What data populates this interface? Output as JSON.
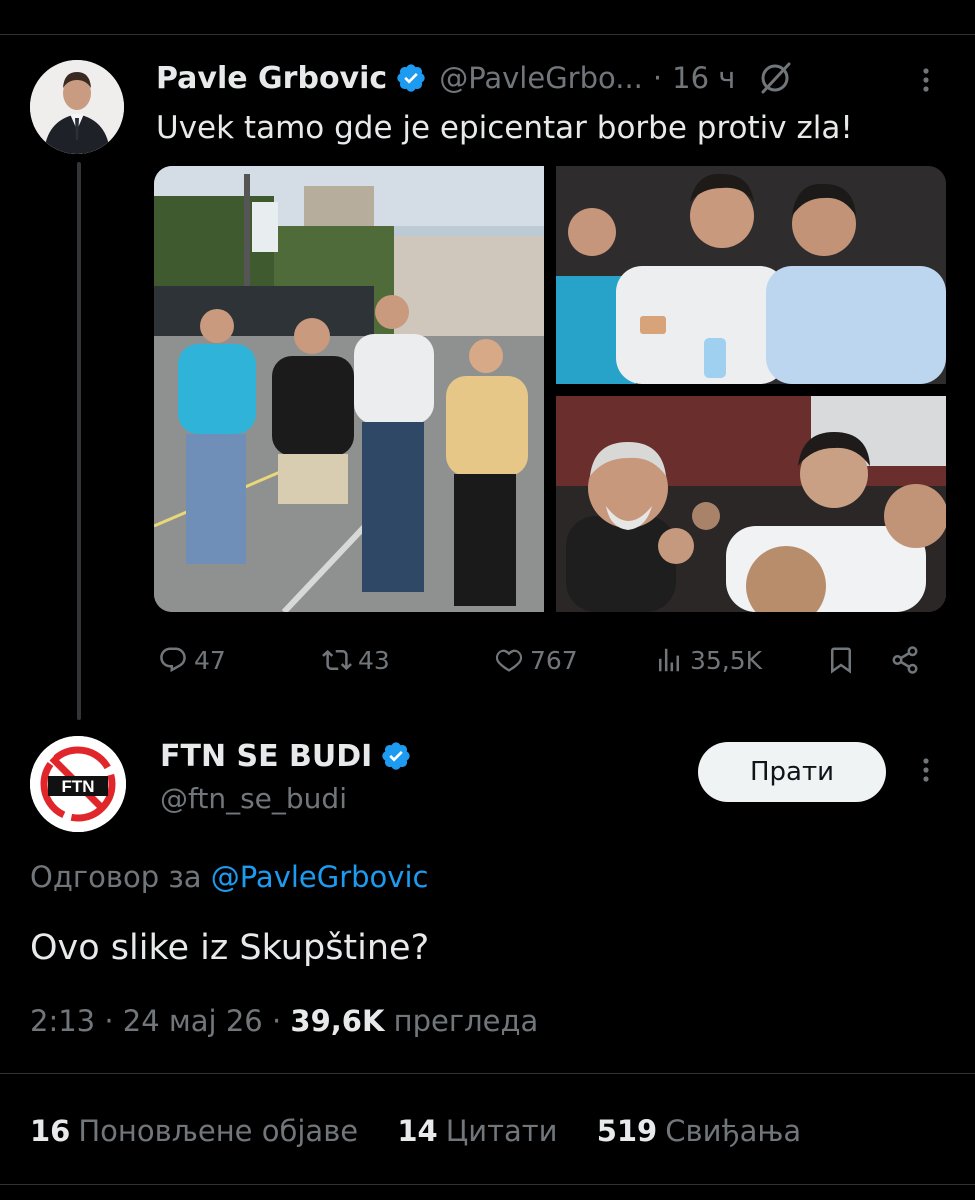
{
  "colors": {
    "background": "#000000",
    "text_primary": "#e7e9ea",
    "text_secondary": "#71767b",
    "accent": "#1d9bf0",
    "verified": "#1d9bf0",
    "divider": "#2f3336"
  },
  "original_tweet": {
    "author_name": "Pavle Grbovic",
    "handle": "@PavleGrbo...",
    "separator": "·",
    "time": "16 ч",
    "text": "Uvek tamo gde je epicentar borbe protiv zla!",
    "icons": [
      "verified-badge-icon",
      "grok-icon",
      "more-icon"
    ],
    "media_icons": [
      "photo-1",
      "photo-2",
      "photo-3"
    ],
    "actions": {
      "replies": "47",
      "reposts": "43",
      "likes": "767",
      "views": "35,5K"
    }
  },
  "reply_tweet": {
    "author_name": "FTN SE BUDI",
    "handle": "@ftn_se_budi",
    "follow_label": "Прати",
    "replying_to_prefix": "Одговор за",
    "replying_to_handle": "@PavleGrbovic",
    "text": "Ovo slike iz Skupštine?",
    "time": "2:13",
    "date": "24 мај 26",
    "views_count": "39,6K",
    "views_label": "прегледа",
    "stats": {
      "reposts_count": "16",
      "reposts_label": "Поновљене објаве",
      "quotes_count": "14",
      "quotes_label": "Цитати",
      "likes_count": "519",
      "likes_label": "Свиђања"
    }
  }
}
